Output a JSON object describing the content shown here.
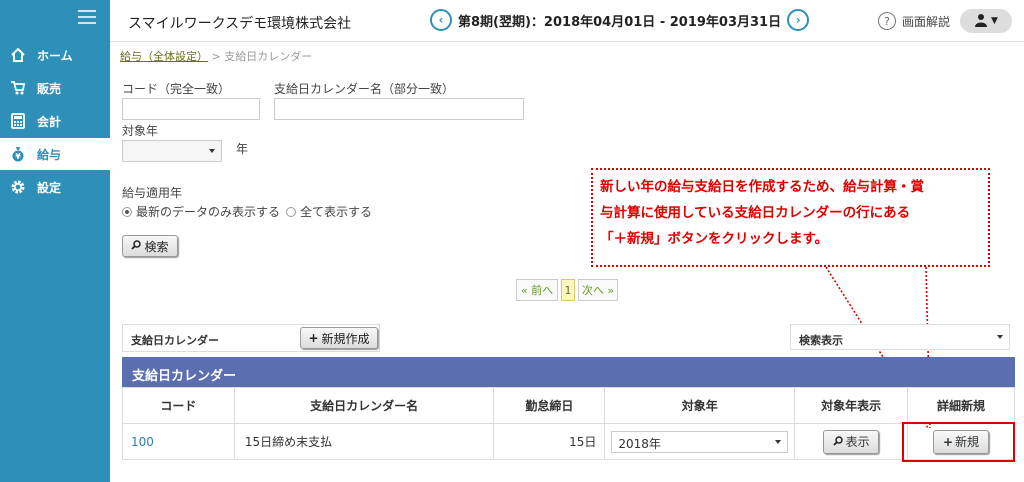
{
  "sidebar": {
    "items": [
      {
        "label": "ホーム",
        "icon": "home-icon"
      },
      {
        "label": "販売",
        "icon": "cart-icon"
      },
      {
        "label": "会計",
        "icon": "calculator-icon"
      },
      {
        "label": "給与",
        "icon": "moneybag-icon"
      },
      {
        "label": "設定",
        "icon": "gear-icon"
      }
    ],
    "active_index": 3,
    "color": "#2e8fb8"
  },
  "header": {
    "company": "スマイルワークスデモ環境株式会社",
    "period": "第8期(翌期)：2018年04月01日 - 2019年03月31日",
    "help_label": "画面解説"
  },
  "breadcrumb": {
    "parent": "給与（全体設定）",
    "separator": ">",
    "current": "支給日カレンダー"
  },
  "search": {
    "code_label": "コード（完全一致）",
    "code_value": "",
    "name_label": "支給日カレンダー名（部分一致）",
    "name_value": "",
    "year_label": "対象年",
    "year_value": "",
    "year_suffix": "年",
    "apply_year_label": "給与適用年",
    "radio_latest": "最新のデータのみ表示する",
    "radio_all": "全て表示する",
    "search_button": "検索"
  },
  "pagination": {
    "prev": "« 前へ",
    "current": "1",
    "next": "次へ »"
  },
  "callout": {
    "lines": [
      "新しい年の給与支給日を作成するため、給与計算・賞",
      "与計算に使用している支給日カレンダーの行にある",
      "「＋新規」ボタンをクリックします。"
    ],
    "color": "#e00000"
  },
  "toolbar": {
    "calendar_label": "支給日カレンダー",
    "new_create_button": "新規作成",
    "search_display_label": "検索表示"
  },
  "table": {
    "title": "支給日カレンダー",
    "headers": [
      "コード",
      "支給日カレンダー名",
      "勤怠締日",
      "対象年",
      "対象年表示",
      "詳細新規"
    ],
    "rows": [
      {
        "code": "100",
        "name": "15日締め末支払",
        "close_day": "15日",
        "year": "2018年",
        "show_button": "表示",
        "new_button": "新規"
      }
    ]
  }
}
